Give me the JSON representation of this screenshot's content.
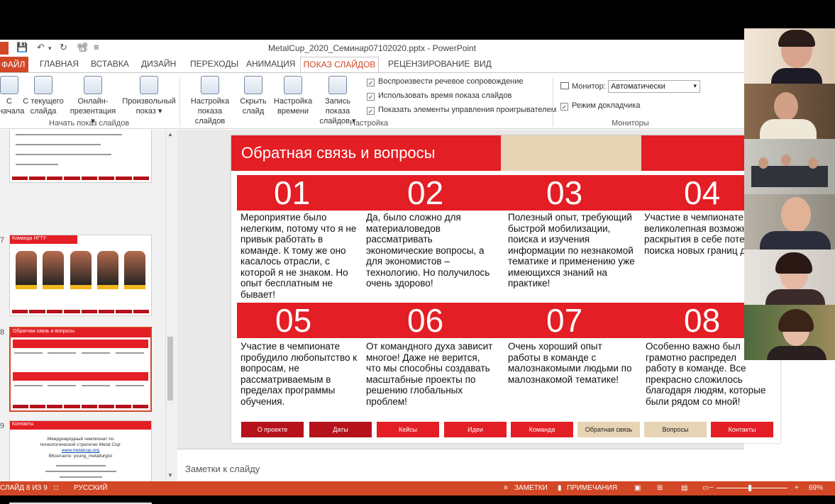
{
  "window": {
    "title": "MetalCup_2020_Семинар07102020.pptx - PowerPoint"
  },
  "tabs": {
    "file": "ФАЙЛ",
    "items": [
      "ГЛАВНАЯ",
      "ВСТАВКА",
      "ДИЗАЙН",
      "ПЕРЕХОДЫ",
      "АНИМАЦИЯ"
    ],
    "active": "ПОКАЗ СЛАЙДОВ",
    "after": [
      "РЕЦЕНЗИРОВАНИЕ",
      "ВИД"
    ]
  },
  "ribbon": {
    "start": {
      "from_start_1": "С",
      "from_start_2": "начала",
      "from_current_1": "С текущего",
      "from_current_2": "слайда",
      "online_1": "Онлайн-",
      "online_2": "презентация ▾",
      "custom_1": "Произвольный",
      "custom_2": "показ ▾",
      "label": "Начать показ слайдов"
    },
    "setup": {
      "setup_1": "Настройка",
      "setup_2": "показа слайдов",
      "hide_1": "Скрыть",
      "hide_2": "слайд",
      "timing_1": "Настройка",
      "timing_2": "времени",
      "record_1": "Запись показа",
      "record_2": "слайдов ▾",
      "chk1": "Воспроизвести речевое сопровождение",
      "chk2": "Использовать время показа слайдов",
      "chk3": "Показать элементы управления проигрывателем",
      "label": "Настройка"
    },
    "monitors": {
      "monitor_label": "Монитор:",
      "monitor_value": "Автоматически",
      "presenter": "Режим докладчика",
      "label": "Мониторы"
    }
  },
  "thumbs": {
    "n7": "7",
    "n8": "8",
    "n9": "9",
    "t7": "Команда НГТУ",
    "t8": "Обратная связь и вопросы",
    "t9": "Контакты",
    "t9_l1": "Международный чемпионат по",
    "t9_l2": "технологической стратегии Metal Cup:",
    "t9_l3": "www.metalcup.org",
    "t9_l4": "ВКонтакте: young_metallurgist"
  },
  "slide": {
    "title": "Обратная связь и вопросы",
    "cells": [
      {
        "num": "01",
        "text": "Мероприятие было нелегким, потому что я не привык работать в команде. К тому же оно касалось отрасли, с которой я не знаком. Но опыт бесплатным не бывает!"
      },
      {
        "num": "02",
        "text": "Да, было сложно для материаловедов рассматривать экономические вопросы, а для экономистов – технологию. Но получилось очень здорово!"
      },
      {
        "num": "03",
        "text": "Полезный опыт, требующий быстрой мобилизации, поиска и изучения информации по незнакомой тематике и применению уже имеющихся знаний на практике!"
      },
      {
        "num": "04",
        "text": "Участие в чемпионате это великолепная возможность для раскрытия в себе потенциала и поиска новых границ для разв"
      },
      {
        "num": "05",
        "text": "Участие в чемпионате пробудило любопытство к вопросам, не рассматриваемым в пределах программы обучения."
      },
      {
        "num": "06",
        "text": "От командного духа зависит многое! Даже не верится, что мы способны создавать масштабные проекты по решению глобальных проблем!"
      },
      {
        "num": "07",
        "text": "Очень хороший опыт работы в команде с малознакомыми людьми по малознакомой тематике!"
      },
      {
        "num": "08",
        "text": "Особенно важно был грамотно распредел работу в команде. Все прекрасно сложилось благодаря людям, которые были рядом со мной!"
      }
    ],
    "nav": [
      "О проекте",
      "Даты",
      "Кейсы",
      "Идеи",
      "Команда",
      "Обратная связь",
      "Вопросы",
      "Контакты"
    ]
  },
  "notes": {
    "placeholder": "Заметки к слайду"
  },
  "status": {
    "slide": "СЛАЙД 8 ИЗ 9",
    "lang": "РУССКИЙ",
    "notes": "ЗАМЕТКИ",
    "comments": "ПРИМЕЧАНИЯ",
    "zoom": "69%"
  },
  "colors": {
    "accent": "#d24726",
    "slide_red": "#e31e24",
    "slide_beige": "#e6d4b5",
    "nav_dark": "#b5121b"
  }
}
